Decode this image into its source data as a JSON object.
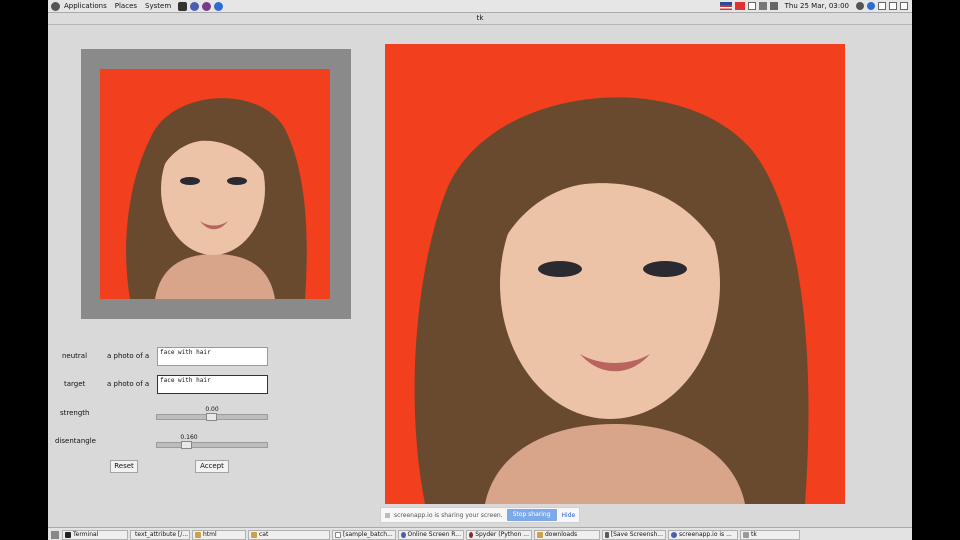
{
  "top_panel": {
    "menus": [
      "Applications",
      "Places",
      "System"
    ],
    "clock": "Thu 25 Mar, 03:00"
  },
  "window": {
    "title": "tk"
  },
  "form": {
    "neutral": {
      "label": "neutral",
      "prefix": "a photo of a",
      "value": "face with hair"
    },
    "target": {
      "label": "target",
      "prefix": "a photo of a",
      "value": "face with hair"
    },
    "strength": {
      "label": "strength",
      "value": "0.00"
    },
    "disentangle": {
      "label": "disentangle",
      "value": "0.160"
    },
    "reset_label": "Reset",
    "accept_label": "Accept"
  },
  "share_banner": {
    "text": "screenapp.io is sharing your screen.",
    "stop_label": "Stop sharing",
    "hide_label": "Hide"
  },
  "taskbar": {
    "items": [
      "Terminal",
      "text_attribute [/...",
      "html",
      "cat",
      "[sample_batch...",
      "Online Screen R...",
      "Spyder (Python ...",
      "downloads",
      "[Save Screensh...",
      "screenapp.io is ...",
      "tk"
    ]
  },
  "colors": {
    "photo_background": "#f23f1e",
    "window_bg": "#d9d9d9",
    "frame": "#8a8a8a"
  }
}
